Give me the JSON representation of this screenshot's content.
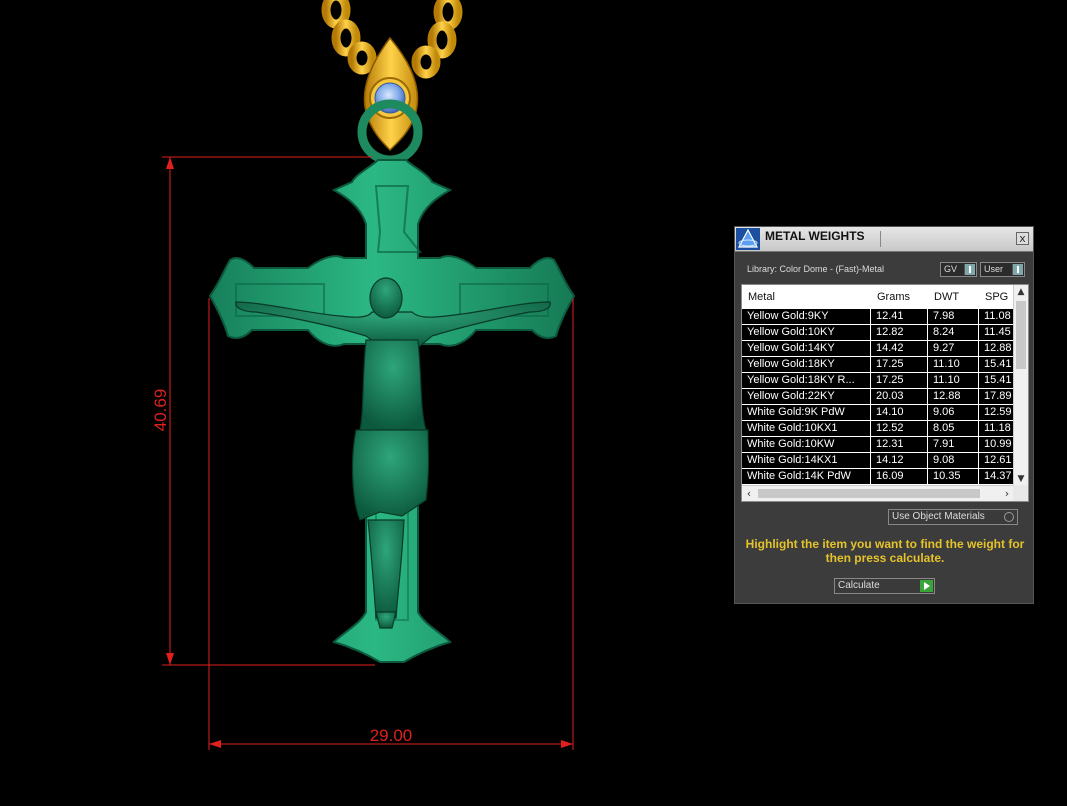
{
  "dimensions": {
    "height_label": "40.69",
    "width_label": "29.00"
  },
  "colors": {
    "dimension": "#e0201e",
    "cross": "#1f9a6a",
    "gold": "#f0b419",
    "gem": "#7fa8e8",
    "hint": "#e5c32a"
  },
  "panel": {
    "title": "METAL WEIGHTS",
    "close_label": "x",
    "library_label": "Library: Color Dome - (Fast)-Metal",
    "gv_select": "GV",
    "user_select": "User",
    "table": {
      "headers": [
        "Metal",
        "Grams",
        "DWT",
        "SPG"
      ],
      "rows": [
        [
          "Yellow Gold:9KY",
          "12.41",
          "7.98",
          "11.08"
        ],
        [
          "Yellow Gold:10KY",
          "12.82",
          "8.24",
          "11.45"
        ],
        [
          "Yellow Gold:14KY",
          "14.42",
          "9.27",
          "12.88"
        ],
        [
          "Yellow Gold:18KY",
          "17.25",
          "11.10",
          "15.41"
        ],
        [
          "Yellow Gold:18KY R...",
          "17.25",
          "11.10",
          "15.41"
        ],
        [
          "Yellow Gold:22KY",
          "20.03",
          "12.88",
          "17.89"
        ],
        [
          "White Gold:9K PdW",
          "14.10",
          "9.06",
          "12.59"
        ],
        [
          "White Gold:10KX1",
          "12.52",
          "8.05",
          "11.18"
        ],
        [
          "White Gold:10KW",
          "12.31",
          "7.91",
          "10.99"
        ],
        [
          "White Gold:14KX1",
          "14.12",
          "9.08",
          "12.61"
        ],
        [
          "White Gold:14K PdW",
          "16.09",
          "10.35",
          "14.37"
        ]
      ]
    },
    "use_object_materials": "Use Object Materials",
    "hint": "Highlight the item you want to find the weight for then press calculate.",
    "calculate_label": "Calculate"
  }
}
